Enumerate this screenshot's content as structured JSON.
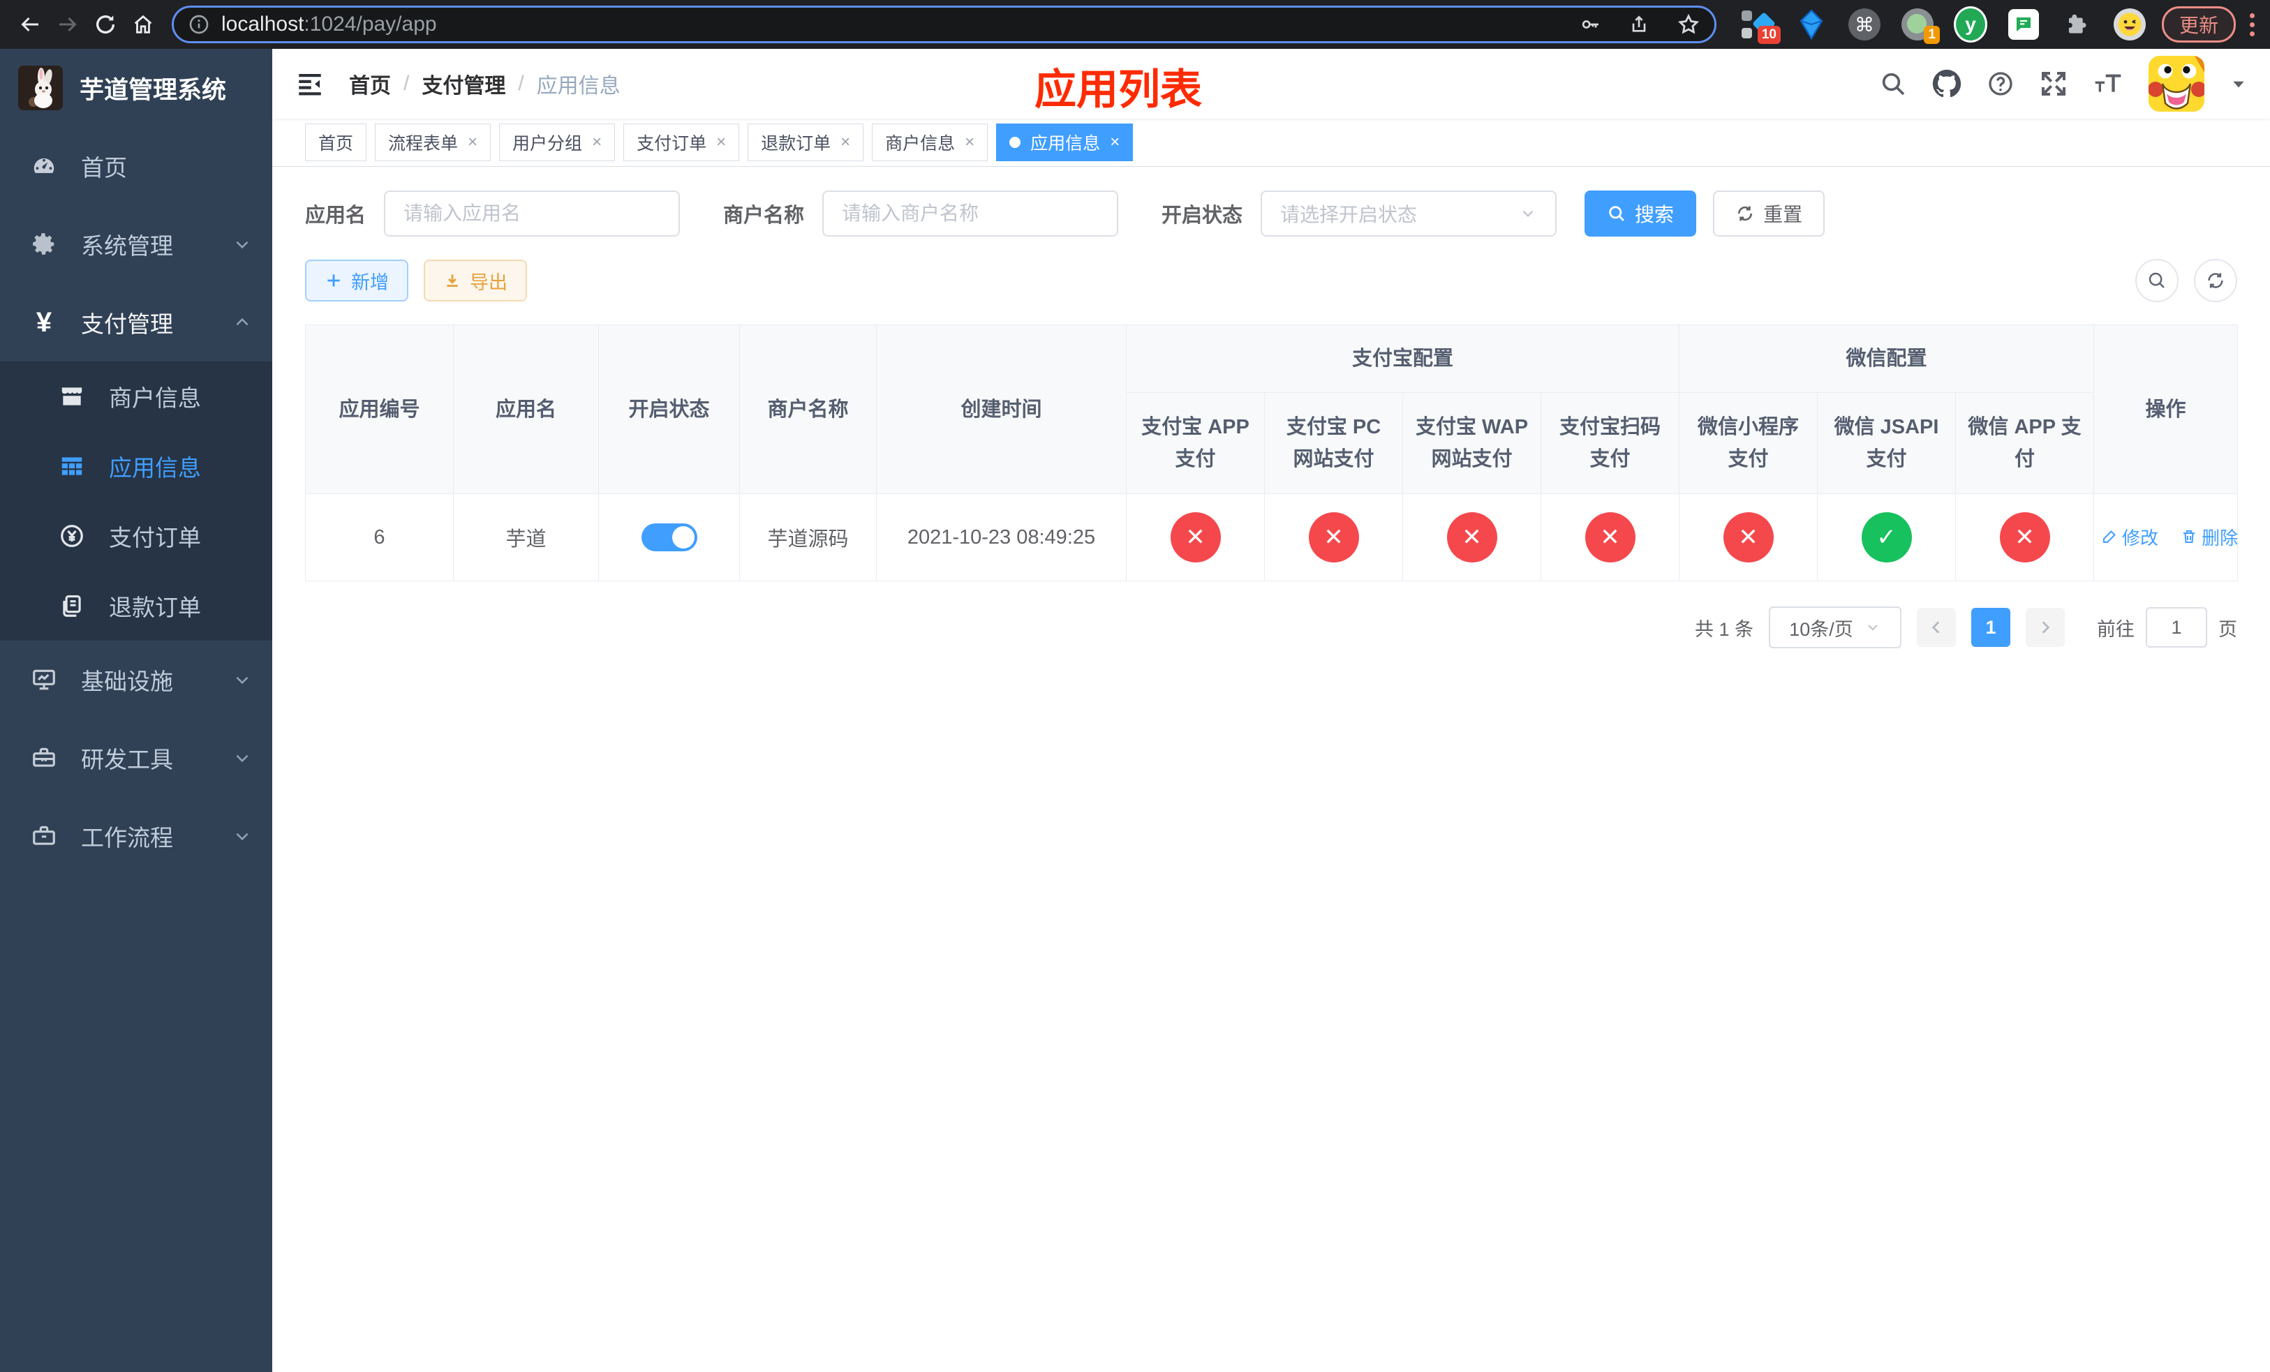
{
  "browser": {
    "url": {
      "host": "localhost",
      "path": ":1024/pay/app"
    },
    "update_button": "更新",
    "ext_badges": {
      "ten": "10",
      "one": "1"
    },
    "ext_y_label": "y",
    "cmd_glyph": "⌘"
  },
  "sidebar": {
    "app_title": "芋道管理系统",
    "menu_top": [
      {
        "label": "首页"
      },
      {
        "label": "系统管理"
      },
      {
        "label": "支付管理"
      }
    ],
    "submenu": [
      {
        "label": "商户信息"
      },
      {
        "label": "应用信息"
      },
      {
        "label": "支付订单"
      },
      {
        "label": "退款订单"
      }
    ],
    "menu_bottom": [
      {
        "label": "基础设施"
      },
      {
        "label": "研发工具"
      },
      {
        "label": "工作流程"
      }
    ]
  },
  "navbar": {
    "breadcrumb": [
      "首页",
      "支付管理",
      "应用信息"
    ],
    "overlay_title": "应用列表"
  },
  "tabs": [
    {
      "label": "首页"
    },
    {
      "label": "流程表单"
    },
    {
      "label": "用户分组"
    },
    {
      "label": "支付订单"
    },
    {
      "label": "退款订单"
    },
    {
      "label": "商户信息"
    },
    {
      "label": "应用信息"
    }
  ],
  "filters": {
    "app_name": {
      "label": "应用名",
      "placeholder": "请输入应用名",
      "value": ""
    },
    "merchant_name": {
      "label": "商户名称",
      "placeholder": "请输入商户名称",
      "value": ""
    },
    "status": {
      "label": "开启状态",
      "placeholder": "请选择开启状态",
      "value": ""
    },
    "search_button": "搜索",
    "reset_button": "重置"
  },
  "toolbar": {
    "add_button": "新增",
    "export_button": "导出"
  },
  "table": {
    "columns": [
      "应用编号",
      "应用名",
      "开启状态",
      "商户名称",
      "创建时间"
    ],
    "groups": [
      {
        "label": "支付宝配置",
        "span": 4
      },
      {
        "label": "微信配置",
        "span": 3
      }
    ],
    "subcolumns": [
      "支付宝 APP 支付",
      "支付宝 PC 网站支付",
      "支付宝 WAP 网站支付",
      "支付宝扫码支付",
      "微信小程序支付",
      "微信 JSAPI 支付",
      "微信 APP 支付"
    ],
    "op_column": "操作",
    "glyph_on": "✓",
    "glyph_off": "✕",
    "row": {
      "id": "6",
      "name": "芋道",
      "enabled": true,
      "merchant": "芋道源码",
      "created_at": "2021-10-23 08:49:25",
      "configs": [
        false,
        false,
        false,
        false,
        false,
        true,
        false
      ],
      "edit_label": "修改",
      "delete_label": "删除"
    }
  },
  "pagination": {
    "total": "共 1 条",
    "page_size": "10条/页",
    "current_page": "1",
    "goto_label": "前往",
    "goto_value": "1",
    "goto_unit": "页"
  },
  "colors": {
    "accent": "#409EFF",
    "danger": "#f5484d",
    "success": "#17c15d",
    "overlay_title": "#fe2b00",
    "sidebar_bg": "#304156",
    "submenu_bg": "#263445"
  }
}
